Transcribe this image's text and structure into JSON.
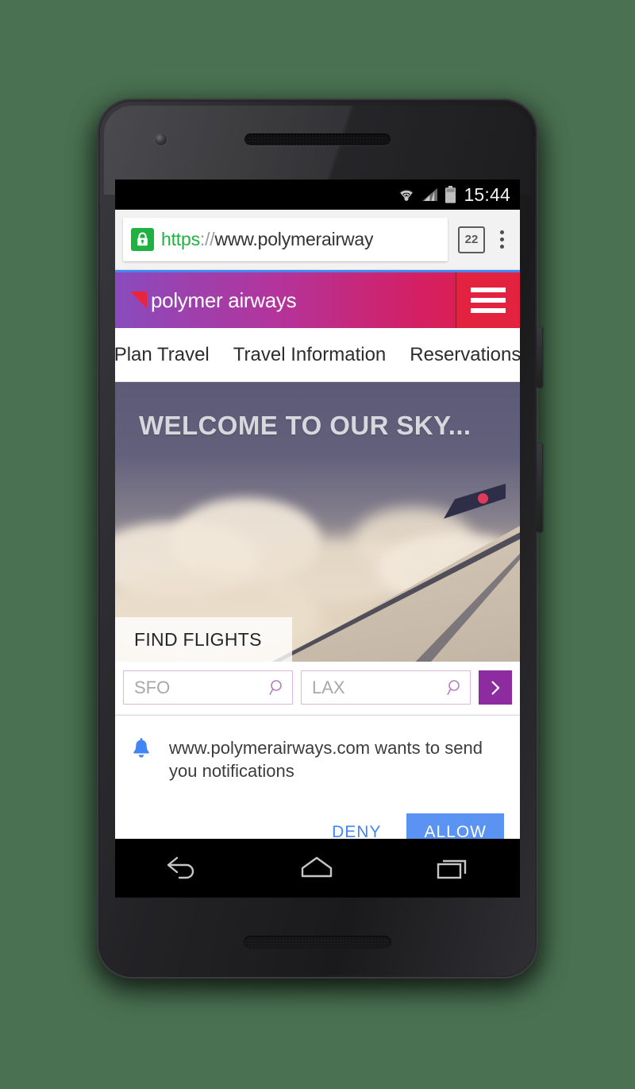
{
  "status_bar": {
    "clock": "15:44",
    "icons": [
      "wifi-icon",
      "signal-icon",
      "battery-icon"
    ]
  },
  "browser": {
    "url_scheme": "https",
    "url_separator": "://",
    "url_host": "www.polymerairway",
    "lock_icon": "lock-icon",
    "tab_count": "22",
    "menu_icon": "overflow-menu-icon"
  },
  "site": {
    "brand": "polymer airways",
    "brand_mark": "triangle-logo-icon",
    "menu_icon": "hamburger-menu-icon",
    "nav": [
      {
        "label": "Plan Travel"
      },
      {
        "label": "Travel Information"
      },
      {
        "label": "Reservations"
      }
    ],
    "hero": {
      "title": "WELCOME TO OUR SKY...",
      "tab_label": "FIND FLIGHTS"
    },
    "search": {
      "origin_placeholder": "SFO",
      "origin_value": "",
      "destination_placeholder": "LAX",
      "destination_value": "",
      "search_icon": "magnifier-icon",
      "submit_icon": "chevron-right-icon"
    }
  },
  "permission_dialog": {
    "icon": "bell-icon",
    "origin": "www.polymerairways.com",
    "message": " wants to send you notifications",
    "deny_label": "DENY",
    "allow_label": "ALLOW"
  },
  "android_nav": {
    "back": "back-icon",
    "home": "home-icon",
    "recents": "recents-icon"
  },
  "colors": {
    "background": "#4a7252",
    "brand_gradient_start": "#8a4bbd",
    "brand_gradient_end": "#e31e3c",
    "menu_red": "#e3223f",
    "accent_purple": "#8d2ba0",
    "allow_blue": "#5b93f2",
    "lock_green": "#1fb141",
    "progress_blue": "#4285f4"
  }
}
